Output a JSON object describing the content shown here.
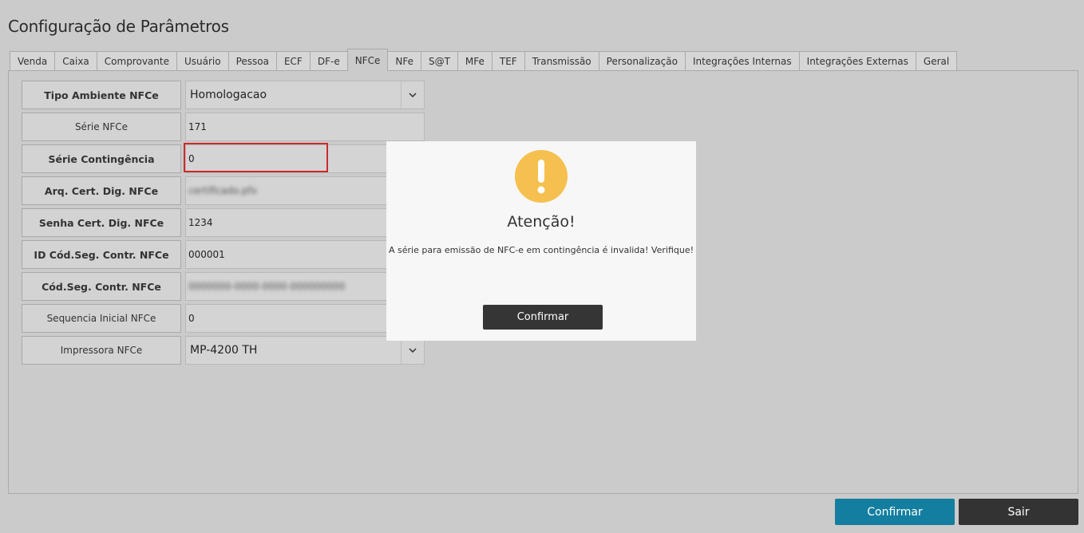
{
  "page": {
    "title": "Configuração de Parâmetros"
  },
  "tabs": [
    {
      "label": "Venda",
      "active": false
    },
    {
      "label": "Caixa",
      "active": false
    },
    {
      "label": "Comprovante",
      "active": false
    },
    {
      "label": "Usuário",
      "active": false
    },
    {
      "label": "Pessoa",
      "active": false
    },
    {
      "label": "ECF",
      "active": false
    },
    {
      "label": "DF-e",
      "active": false
    },
    {
      "label": "NFCe",
      "active": true
    },
    {
      "label": "NFe",
      "active": false
    },
    {
      "label": "S@T",
      "active": false
    },
    {
      "label": "MFe",
      "active": false
    },
    {
      "label": "TEF",
      "active": false
    },
    {
      "label": "Transmissão",
      "active": false
    },
    {
      "label": "Personalização",
      "active": false
    },
    {
      "label": "Integrações Internas",
      "active": false
    },
    {
      "label": "Integrações Externas",
      "active": false
    },
    {
      "label": "Geral",
      "active": false
    }
  ],
  "form": {
    "tipo_ambiente": {
      "label": "Tipo Ambiente NFCe",
      "value": "Homologacao"
    },
    "serie": {
      "label": "Série NFCe",
      "value": "171"
    },
    "serie_contingencia": {
      "label": "Série Contingência",
      "value": "0"
    },
    "arq_cert": {
      "label": "Arq. Cert. Dig. NFCe",
      "value": "certificado.pfx"
    },
    "senha_cert": {
      "label": "Senha Cert. Dig. NFCe",
      "value": "1234"
    },
    "id_cod_seg": {
      "label": "ID Cód.Seg. Contr. NFCe",
      "value": "000001"
    },
    "cod_seg": {
      "label": "Cód.Seg. Contr. NFCe",
      "value": "0000000-0000-0000-000000000"
    },
    "sequencia_inicial": {
      "label": "Sequencia Inicial NFCe",
      "value": "0"
    },
    "impressora": {
      "label": "Impressora NFCe",
      "value": "MP-4200 TH"
    }
  },
  "dialog": {
    "title": "Atenção!",
    "message": "A série para emissão de NFC-e em contingência é invalida! Verifique!",
    "confirm_label": "Confirmar",
    "icon": "exclamation-icon",
    "icon_color": "#f5c04f"
  },
  "footer": {
    "confirm_label": "Confirmar",
    "exit_label": "Sair"
  },
  "colors": {
    "confirm_button": "#137e9f",
    "exit_button": "#333333",
    "error_highlight": "#cc2a2a"
  }
}
